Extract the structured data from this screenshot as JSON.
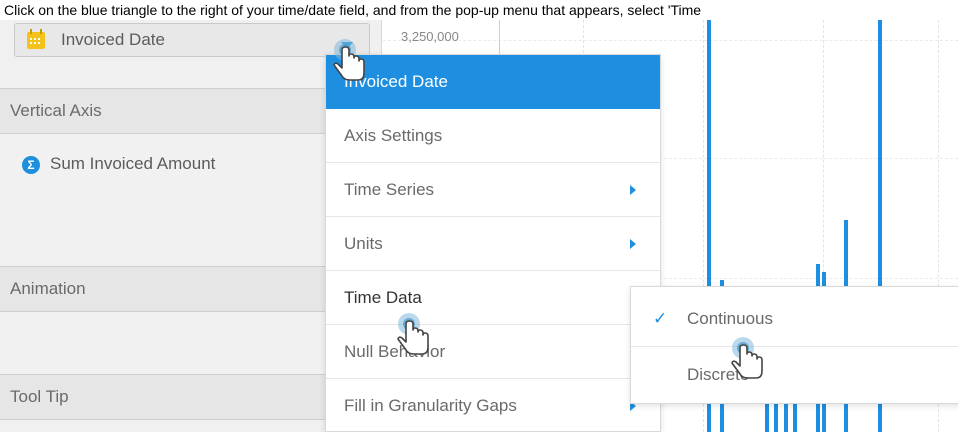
{
  "instruction": "Click on the blue triangle to the right of your time/date field, and from the pop-up menu that appears, select 'Time",
  "left_panel": {
    "field_label": "Invoiced Date",
    "sections": [
      {
        "title": "Vertical Axis"
      },
      {
        "title": "Animation"
      },
      {
        "title": "Tool Tip"
      }
    ],
    "vertical_axis_item": "Sum Invoiced Amount"
  },
  "chart": {
    "y_tick": "3,250,000",
    "line_color": "#1e8fe0"
  },
  "context_menu": {
    "items": [
      {
        "label": "Invoiced Date",
        "submenu": false
      },
      {
        "label": "Axis Settings",
        "submenu": false
      },
      {
        "label": "Time Series",
        "submenu": true
      },
      {
        "label": "Units",
        "submenu": true
      },
      {
        "label": "Time Data",
        "submenu": false
      },
      {
        "label": "Null Behavior",
        "submenu": false
      },
      {
        "label": "Fill in Granularity Gaps",
        "submenu": true
      }
    ]
  },
  "submenu": {
    "items": [
      {
        "label": "Continuous",
        "checked": true
      },
      {
        "label": "Discrete",
        "checked": false
      }
    ]
  },
  "colors": {
    "accent": "#1e8fe0",
    "calendar_icon": "#f3c21b"
  }
}
